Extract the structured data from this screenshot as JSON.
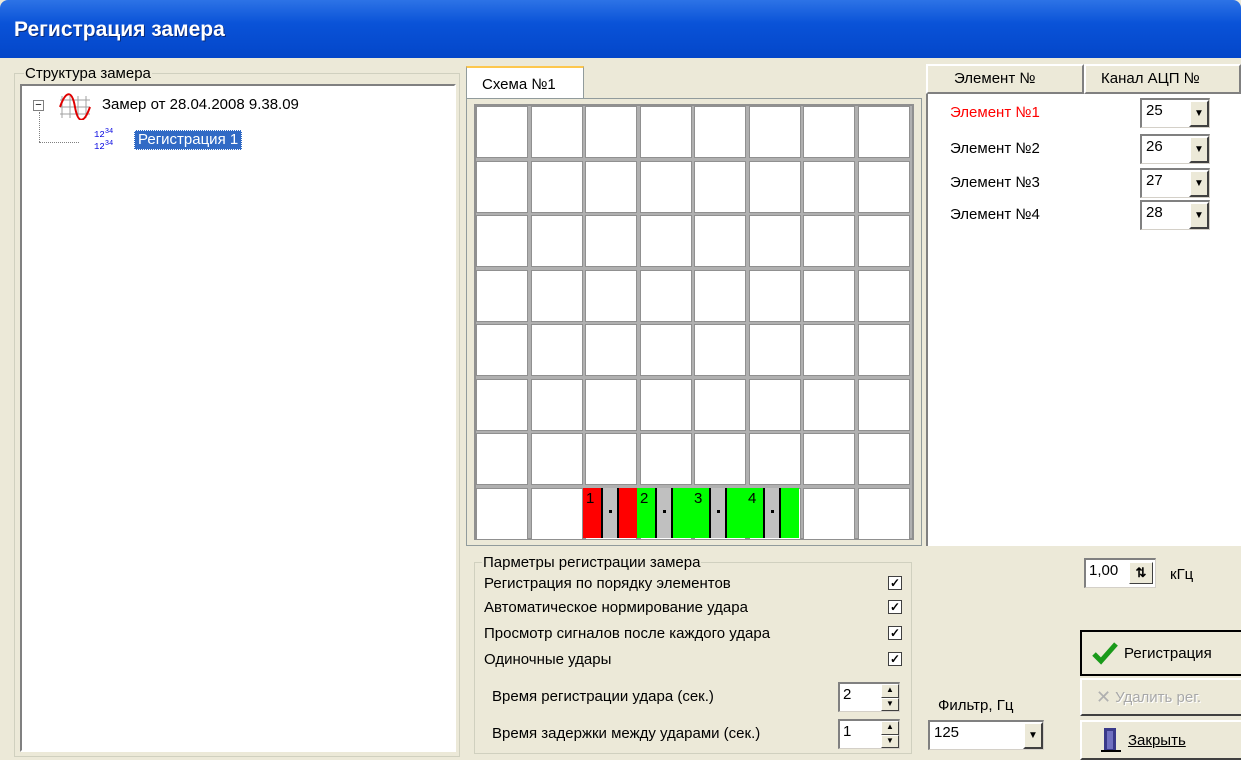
{
  "window": {
    "title": "Регистрация замера"
  },
  "tree": {
    "group_title": "Структура замера",
    "root_label": "Замер от 28.04.2008 9.38.09",
    "child_label": "Регистрация 1"
  },
  "scheme": {
    "tab_label": "Схема №1",
    "element_numbers": [
      "1",
      "2",
      "3",
      "4"
    ]
  },
  "channels": {
    "col_element": "Элемент №",
    "col_channel": "Канал АЦП №",
    "rows": [
      {
        "element": "Элемент №1",
        "channel": "25",
        "color": "#ff0000"
      },
      {
        "element": "Элемент №2",
        "channel": "26",
        "color": "#000000"
      },
      {
        "element": "Элемент №3",
        "channel": "27",
        "color": "#000000"
      },
      {
        "element": "Элемент №4",
        "channel": "28",
        "color": "#000000"
      }
    ]
  },
  "params": {
    "group_title": "Парметры регистрации замера",
    "check1": "Регистрация по порядку элементов",
    "check2": "Автоматическое нормирование удара",
    "check3": "Просмотр сигналов после каждого удара",
    "check4": "Одиночные удары",
    "check_mark": "✓",
    "time_reg_label": "Время регистрации удара (сек.)",
    "time_reg_value": "2",
    "time_delay_label": "Время задержки между ударами (сек.)",
    "time_delay_value": "1"
  },
  "freq": {
    "value": "1,00",
    "unit": "кГц"
  },
  "filter": {
    "label": "Фильтр, Гц",
    "value": "125"
  },
  "buttons": {
    "register": "Регистрация",
    "delete": "Удалить рег.",
    "close": "Закрыть"
  },
  "colors": {
    "red": "#ff0000",
    "green": "#00ff00",
    "title_blue": "#0a53d8",
    "selection": "#316ac5"
  }
}
